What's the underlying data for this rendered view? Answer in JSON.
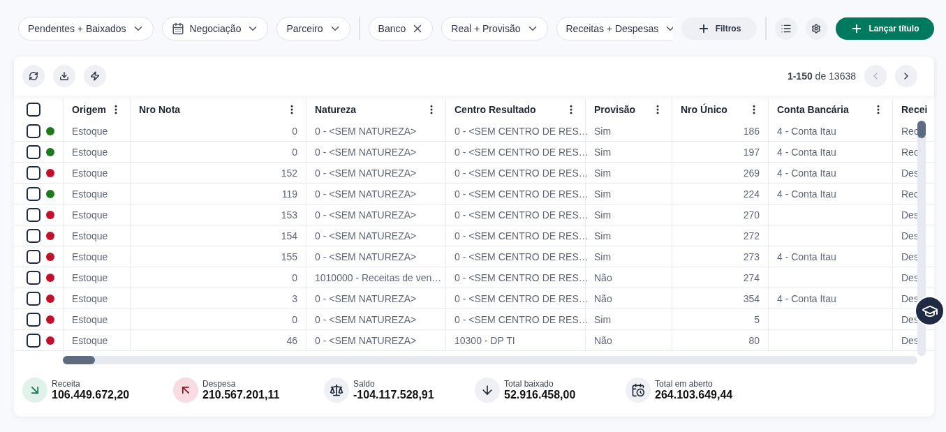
{
  "filter_groups": [
    {
      "filters": [
        {
          "label": "Pendentes + Baixados",
          "kind": "dropdown"
        },
        {
          "label": "Negociação",
          "kind": "date"
        },
        {
          "label": "Parceiro",
          "kind": "dropdown"
        }
      ]
    },
    {
      "filters": [
        {
          "label": "Banco",
          "kind": "removable"
        },
        {
          "label": "Real + Provisão",
          "kind": "dropdown"
        },
        {
          "label": "Receitas + Despesas",
          "kind": "dropdown"
        }
      ]
    }
  ],
  "filters_button": "Filtros",
  "primary_button": "Lançar título",
  "pagination": {
    "range": "1-150",
    "total": "de 13638",
    "prev_disabled": true,
    "next_disabled": false
  },
  "table": {
    "select_all_checked": false,
    "columns": [
      {
        "label": "Origem",
        "kind": "text"
      },
      {
        "label": "Nro Nota",
        "kind": "number"
      },
      {
        "label": "Natureza",
        "kind": "text"
      },
      {
        "label": "Centro Resultado",
        "kind": "text"
      },
      {
        "label": "Provisão",
        "kind": "text"
      },
      {
        "label": "Nro Único",
        "kind": "number"
      },
      {
        "label": "Conta Bancária",
        "kind": "text"
      },
      {
        "label": "Recei",
        "kind": "text"
      }
    ],
    "rows": [
      {
        "checked": false,
        "color": "#1e7a1e",
        "cells": [
          "Estoque",
          "0",
          "0 - <SEM NATUREZA>",
          "0 - <SEM CENTRO DE RES…",
          "Sim",
          "186",
          "4 - Conta Itau",
          "Rec"
        ]
      },
      {
        "checked": false,
        "color": "#1e7a1e",
        "cells": [
          "Estoque",
          "0",
          "0 - <SEM NATUREZA>",
          "0 - <SEM CENTRO DE RES…",
          "Sim",
          "197",
          "4 - Conta Itau",
          "Rec"
        ]
      },
      {
        "checked": false,
        "color": "#c0102a",
        "cells": [
          "Estoque",
          "152",
          "0 - <SEM NATUREZA>",
          "0 - <SEM CENTRO DE RES…",
          "Sim",
          "269",
          "4 - Conta Itau",
          "Des"
        ]
      },
      {
        "checked": false,
        "color": "#1e7a1e",
        "cells": [
          "Estoque",
          "119",
          "0 - <SEM NATUREZA>",
          "0 - <SEM CENTRO DE RES…",
          "Sim",
          "224",
          "4 - Conta Itau",
          "Rec"
        ]
      },
      {
        "checked": false,
        "color": "#c0102a",
        "cells": [
          "Estoque",
          "153",
          "0 - <SEM NATUREZA>",
          "0 - <SEM CENTRO DE RES…",
          "Sim",
          "270",
          "",
          "Des"
        ]
      },
      {
        "checked": false,
        "color": "#c0102a",
        "cells": [
          "Estoque",
          "154",
          "0 - <SEM NATUREZA>",
          "0 - <SEM CENTRO DE RES…",
          "Sim",
          "272",
          "",
          "Des"
        ]
      },
      {
        "checked": false,
        "color": "#c0102a",
        "cells": [
          "Estoque",
          "155",
          "0 - <SEM NATUREZA>",
          "0 - <SEM CENTRO DE RES…",
          "Sim",
          "273",
          "4 - Conta Itau",
          "Des"
        ]
      },
      {
        "checked": false,
        "color": "#c0102a",
        "cells": [
          "Estoque",
          "0",
          "1010000 - Receitas de ven…",
          "0 - <SEM CENTRO DE RES…",
          "Não",
          "274",
          "",
          "Des"
        ]
      },
      {
        "checked": false,
        "color": "#c0102a",
        "cells": [
          "Estoque",
          "3",
          "0 - <SEM NATUREZA>",
          "0 - <SEM CENTRO DE RES…",
          "Não",
          "354",
          "4 - Conta Itau",
          "Des"
        ]
      },
      {
        "checked": false,
        "color": "#c0102a",
        "cells": [
          "Estoque",
          "0",
          "0 - <SEM NATUREZA>",
          "0 - <SEM CENTRO DE RES…",
          "Sim",
          "5",
          "",
          "Des"
        ]
      },
      {
        "checked": false,
        "color": "#c0102a",
        "cells": [
          "Estoque",
          "46",
          "0 - <SEM NATUREZA>",
          "10300 - DP TI",
          "Não",
          "80",
          "",
          "Des"
        ]
      }
    ]
  },
  "summary": [
    {
      "kind": "income",
      "label": "Receita",
      "value": "106.449.672,20"
    },
    {
      "kind": "expense",
      "label": "Despesa",
      "value": "210.567.201,11"
    },
    {
      "kind": "balance",
      "label": "Saldo",
      "value": "-104.117.528,91"
    },
    {
      "kind": "settled",
      "label": "Total baixado",
      "value": "52.916.458,00"
    },
    {
      "kind": "open",
      "label": "Total em aberto",
      "value": "264.103.649,44"
    }
  ]
}
